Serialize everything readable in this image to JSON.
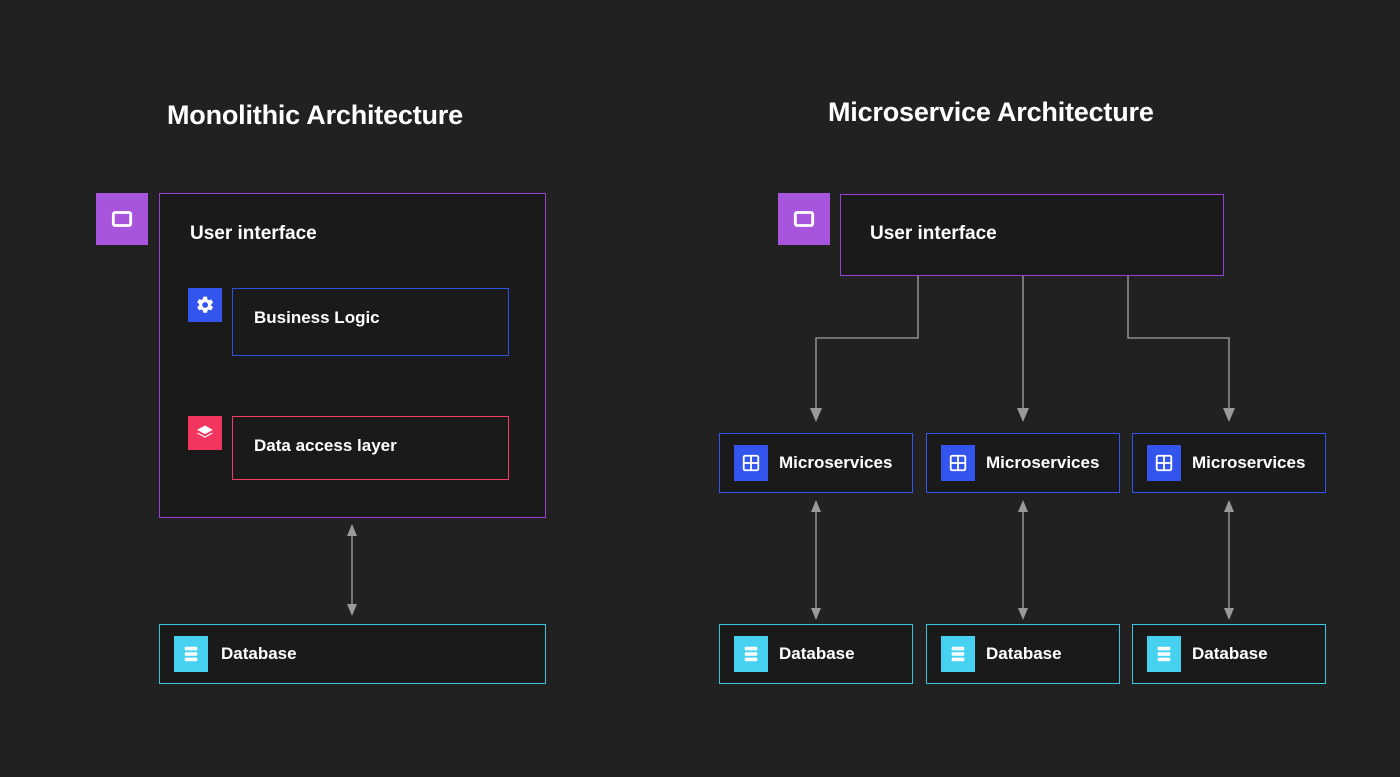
{
  "background_color": "#212121",
  "panels": [
    {
      "id": "monolithic",
      "title": "Monolithic Architecture",
      "container": {
        "label": "User interface",
        "border_color": "#9b3fd4",
        "icon": "window-icon",
        "icon_color": "#a855dd",
        "children": [
          {
            "label": "Business Logic",
            "border_color": "#2d4fe0",
            "icon": "gear-icon",
            "icon_color": "#3355ee"
          },
          {
            "label": "Data access layer",
            "border_color": "#f23b64",
            "icon": "layers-icon",
            "icon_color": "#f2365f"
          }
        ]
      },
      "database": {
        "label": "Database",
        "border_color": "#3ac6e0",
        "icon": "database-icon",
        "icon_color": "#45d1ef"
      },
      "connector": {
        "type": "bidirectional-arrow",
        "color": "#8c8c8c"
      }
    },
    {
      "id": "microservice",
      "title": "Microservice Architecture",
      "container": {
        "label": "User interface",
        "border_color": "#9b3fd4",
        "icon": "window-icon",
        "icon_color": "#a855dd"
      },
      "services": [
        {
          "label": "Microservices",
          "border_color": "#3355ee",
          "icon": "grid-icon",
          "icon_color": "#3355ee"
        },
        {
          "label": "Microservices",
          "border_color": "#3355ee",
          "icon": "grid-icon",
          "icon_color": "#3355ee"
        },
        {
          "label": "Microservices",
          "border_color": "#3355ee",
          "icon": "grid-icon",
          "icon_color": "#3355ee"
        }
      ],
      "databases": [
        {
          "label": "Database",
          "border_color": "#3ac6e0",
          "icon": "database-icon",
          "icon_color": "#45d1ef"
        },
        {
          "label": "Database",
          "border_color": "#3ac6e0",
          "icon": "database-icon",
          "icon_color": "#45d1ef"
        },
        {
          "label": "Database",
          "border_color": "#3ac6e0",
          "icon": "database-icon",
          "icon_color": "#45d1ef"
        }
      ],
      "connectors": {
        "ui_to_services": "elbow-arrow-down",
        "services_to_databases": "bidirectional-arrow",
        "color": "#8c8c8c"
      }
    }
  ]
}
